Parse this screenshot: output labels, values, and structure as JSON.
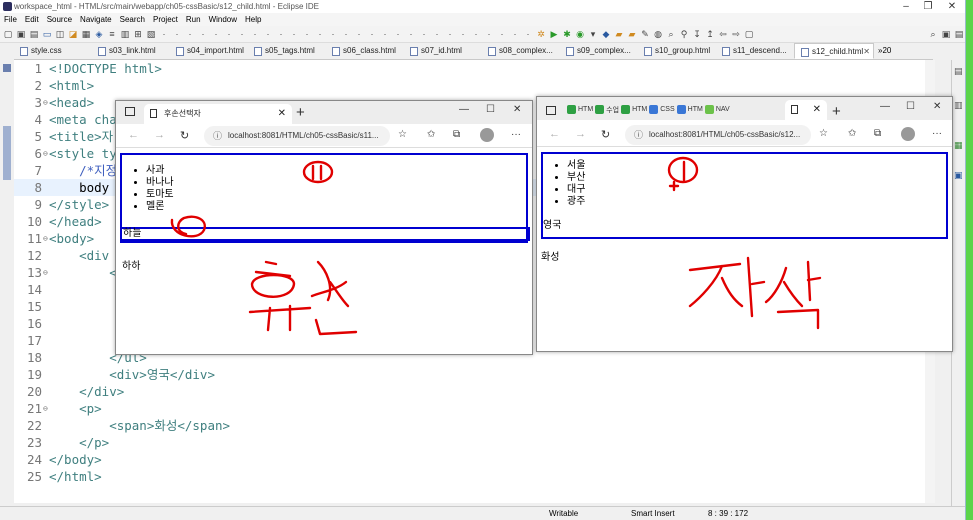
{
  "eclipse": {
    "title": "workspace_html - HTML/src/main/webapp/ch05-cssBasic/s12_child.html - Eclipse IDE",
    "menu": [
      "File",
      "Edit",
      "Source",
      "Navigate",
      "Search",
      "Project",
      "Run",
      "Window",
      "Help"
    ],
    "tabs": [
      {
        "label": "style.css"
      },
      {
        "label": "s03_link.html"
      },
      {
        "label": "s04_import.html"
      },
      {
        "label": "s05_tags.html"
      },
      {
        "label": "s06_class.html"
      },
      {
        "label": "s07_id.html"
      },
      {
        "label": "s08_complex..."
      },
      {
        "label": "s09_complex..."
      },
      {
        "label": "s10_group.html"
      },
      {
        "label": "s11_descend..."
      },
      {
        "label": "s12_child.html"
      }
    ],
    "tab_overflow": "»20",
    "code_lines": [
      {
        "n": "1",
        "t": "<!DOCTYPE html>"
      },
      {
        "n": "2",
        "t": "<html>"
      },
      {
        "n": "3",
        "t": "<head>"
      },
      {
        "n": "4",
        "t": "<meta cha"
      },
      {
        "n": "5",
        "t": "<title>자"
      },
      {
        "n": "6",
        "t": "<style ty"
      },
      {
        "n": "7",
        "t": "    /*지정"
      },
      {
        "n": "8",
        "t": "    body "
      },
      {
        "n": "9",
        "t": "</style>"
      },
      {
        "n": "10",
        "t": "</head>"
      },
      {
        "n": "11",
        "t": "<body>"
      },
      {
        "n": "12",
        "t": "    <div"
      },
      {
        "n": "13",
        "t": "        <"
      },
      {
        "n": "14",
        "t": ""
      },
      {
        "n": "15",
        "t": ""
      },
      {
        "n": "16",
        "t": ""
      },
      {
        "n": "17",
        "t": ""
      },
      {
        "n": "18",
        "t": "        </ul>"
      },
      {
        "n": "19",
        "t": "        <div>영국</div>"
      },
      {
        "n": "20",
        "t": "    </div>"
      },
      {
        "n": "21",
        "t": "    <p>"
      },
      {
        "n": "22",
        "t": "        <span>화성</span>"
      },
      {
        "n": "23",
        "t": "    </p>"
      },
      {
        "n": "24",
        "t": "</body>"
      },
      {
        "n": "25",
        "t": "</html>"
      }
    ],
    "status": {
      "mode": "Writable",
      "insert": "Smart Insert",
      "position": "8 : 39 : 172"
    }
  },
  "browser_left": {
    "tab_title": "후손선택자",
    "url": "localhost:8081/HTML/ch05-cssBasic/s11...",
    "list": [
      "사과",
      "바나나",
      "토마토",
      "멜론"
    ],
    "box_text": "하늘",
    "para": "하하"
  },
  "browser_right": {
    "favs": [
      "HTM",
      "수업",
      "HTM",
      "CSS",
      "HTM",
      "NAV"
    ],
    "url": "localhost:8081/HTML/ch05-cssBasic/s12...",
    "list": [
      "서울",
      "부산",
      "대구",
      "광주"
    ],
    "div_text": "영국",
    "span_text": "화성"
  },
  "annotations": {
    "left_text": "후손",
    "right_text": "자식",
    "left_num": "⑪",
    "right_num": "①",
    "ink_color": "#e00000"
  }
}
